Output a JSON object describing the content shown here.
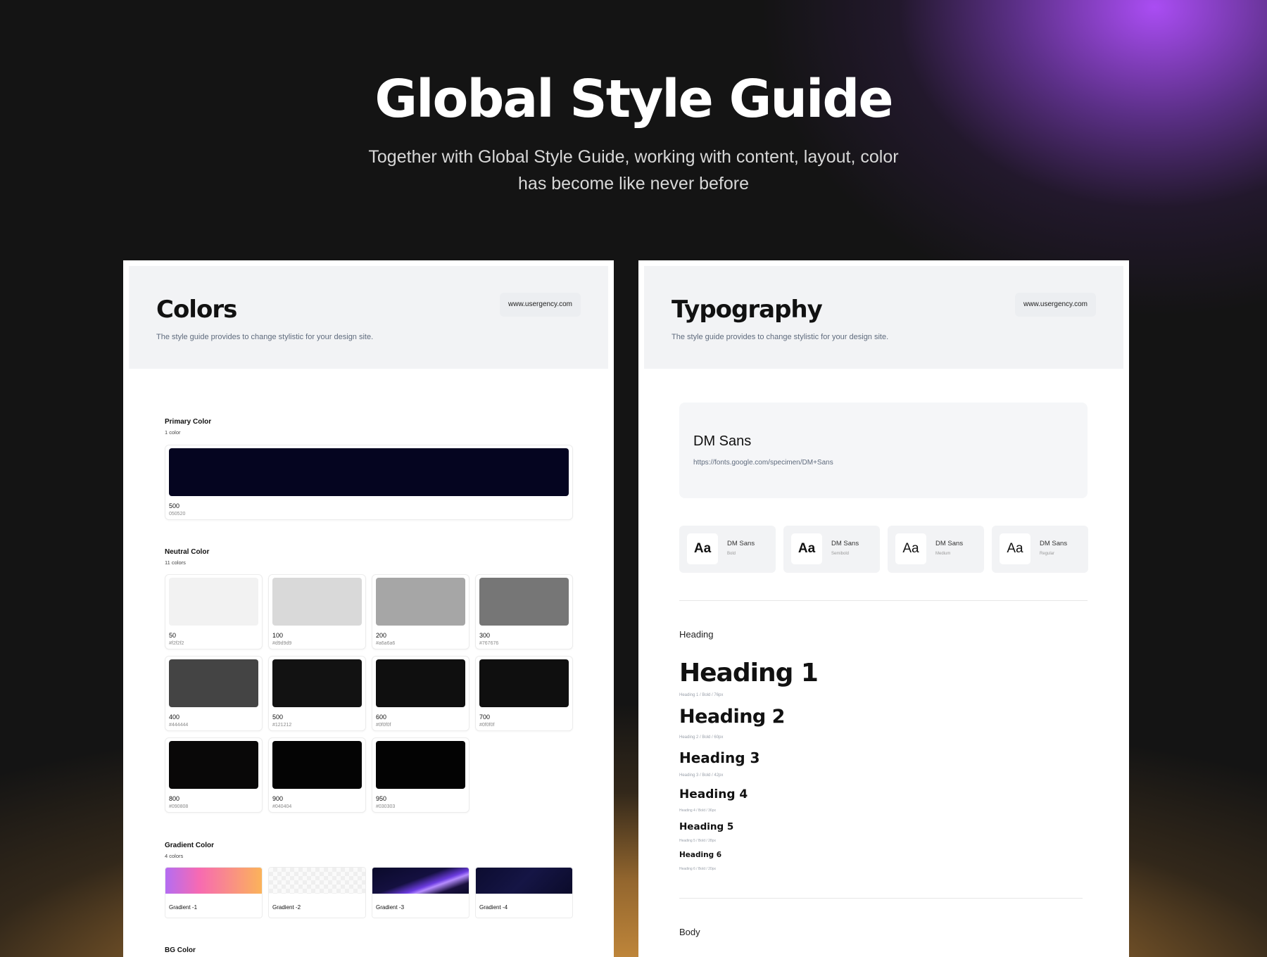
{
  "hero": {
    "title": "Global Style Guide",
    "subtitle_line1": "Together with Global Style Guide, working with content, layout, color",
    "subtitle_line2": "has become like never before"
  },
  "colors_panel": {
    "title": "Colors",
    "description": "The style guide provides to change stylistic for your design site.",
    "url": "www.usergency.com",
    "primary": {
      "title": "Primary Color",
      "count": "1 color",
      "swatch": {
        "name": "500",
        "hex": "050520",
        "color": "#050520"
      }
    },
    "neutral": {
      "title": "Neutral Color",
      "count": "11 colors",
      "swatches": [
        {
          "name": "50",
          "hex": "#f2f2f2",
          "color": "#f2f2f2"
        },
        {
          "name": "100",
          "hex": "#d9d9d9",
          "color": "#d9d9d9"
        },
        {
          "name": "200",
          "hex": "#a6a6a6",
          "color": "#a6a6a6"
        },
        {
          "name": "300",
          "hex": "#767676",
          "color": "#767676"
        },
        {
          "name": "400",
          "hex": "#444444",
          "color": "#444444"
        },
        {
          "name": "500",
          "hex": "#121212",
          "color": "#121212"
        },
        {
          "name": "600",
          "hex": "#0f0f0f",
          "color": "#0f0f0f"
        },
        {
          "name": "700",
          "hex": "#0f0f0f",
          "color": "#0f0f0f"
        },
        {
          "name": "800",
          "hex": "#090808",
          "color": "#090808"
        },
        {
          "name": "900",
          "hex": "#040404",
          "color": "#040404"
        },
        {
          "name": "950",
          "hex": "#030303",
          "color": "#030303"
        }
      ]
    },
    "gradient": {
      "title": "Gradient Color",
      "count": "4 colors",
      "items": [
        {
          "name": "Gradient -1"
        },
        {
          "name": "Gradient -2"
        },
        {
          "name": "Gradient -3"
        },
        {
          "name": "Gradient -4"
        }
      ]
    },
    "bg": {
      "title": "BG Color"
    }
  },
  "typography_panel": {
    "title": "Typography",
    "description": "The style guide provides to change stylistic for your design site.",
    "url": "www.usergency.com",
    "font": {
      "name": "DM Sans",
      "url": "https://fonts.google.com/specimen/DM+Sans"
    },
    "weights": [
      {
        "sample": "Aa",
        "name": "DM Sans",
        "weight": "Bold"
      },
      {
        "sample": "Aa",
        "name": "DM Sans",
        "weight": "Semibold"
      },
      {
        "sample": "Aa",
        "name": "DM Sans",
        "weight": "Medium"
      },
      {
        "sample": "Aa",
        "name": "DM Sans",
        "weight": "Regular"
      }
    ],
    "heading_section": "Heading",
    "headings": [
      {
        "label": "Heading 1",
        "meta": "Heading 1 / Bold / 76px"
      },
      {
        "label": "Heading 2",
        "meta": "Heading 2 / Bold / 60px"
      },
      {
        "label": "Heading 3",
        "meta": "Heading 3 / Bold / 42px"
      },
      {
        "label": "Heading 4",
        "meta": "Heading 4 / Bold / 36px"
      },
      {
        "label": "Heading 5",
        "meta": "Heading 5 / Bold / 28px"
      },
      {
        "label": "Heading 6",
        "meta": "Heading 6 / Bold / 20px"
      }
    ],
    "body_section": "Body"
  }
}
